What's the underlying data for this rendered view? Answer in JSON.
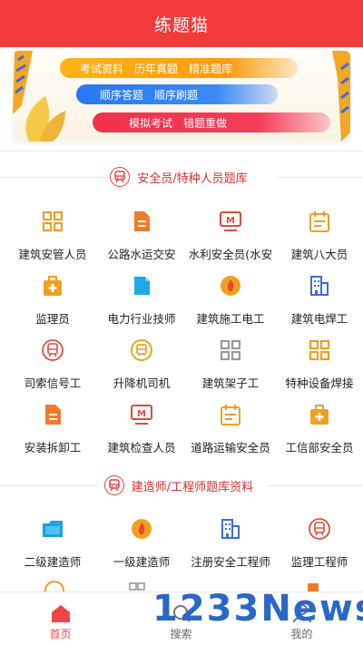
{
  "header": {
    "title": "练题猫"
  },
  "banner": {
    "row1": [
      "考试资料",
      "历年真题",
      "精准题库"
    ],
    "row2": [
      "顺序答题",
      "顺序刷题"
    ],
    "row3": [
      "模拟考试",
      "错题重做"
    ],
    "colors": {
      "orange": "#ffa515",
      "blue": "#2f7ff2",
      "red": "#f2334e"
    }
  },
  "section1": {
    "title": "安全员/特种人员题库",
    "items": [
      {
        "label": "建筑安管人员",
        "icon": "grid-icon"
      },
      {
        "label": "公路水运交安",
        "icon": "document-icon"
      },
      {
        "label": "水利安全员(水安",
        "icon": "monitor-m-icon"
      },
      {
        "label": "建筑八大员",
        "icon": "calendar-icon"
      },
      {
        "label": "监理员",
        "icon": "medical-kit-icon"
      },
      {
        "label": "电力行业技师",
        "icon": "file-icon"
      },
      {
        "label": "建筑施工电工",
        "icon": "fire-icon"
      },
      {
        "label": "建筑电焊工",
        "icon": "building-icon"
      },
      {
        "label": "司索信号工",
        "icon": "train-icon"
      },
      {
        "label": "升降机司机",
        "icon": "bus-icon"
      },
      {
        "label": "建筑架子工",
        "icon": "grid-icon"
      },
      {
        "label": "特种设备焊接",
        "icon": "grid-icon"
      },
      {
        "label": "安装拆卸工",
        "icon": "document-icon"
      },
      {
        "label": "建筑检查人员",
        "icon": "monitor-m-icon"
      },
      {
        "label": "道路运输安全员",
        "icon": "calendar-icon"
      },
      {
        "label": "工信部安全员",
        "icon": "medical-kit-icon"
      }
    ]
  },
  "section2": {
    "title": "建造师/工程师题库资料",
    "items": [
      {
        "label": "二级建造师",
        "icon": "folder-icon"
      },
      {
        "label": "一级建造师",
        "icon": "fire-icon"
      },
      {
        "label": "注册安全工程师",
        "icon": "building-icon"
      },
      {
        "label": "监理工程师",
        "icon": "train-icon"
      }
    ]
  },
  "tabs": [
    {
      "label": "首页",
      "icon": "home-icon",
      "active": true
    },
    {
      "label": "搜索",
      "icon": "search-icon",
      "active": false
    },
    {
      "label": "我的",
      "icon": "user-icon",
      "active": false
    }
  ],
  "watermark": {
    "text_a": "1233",
    "text_b": "News"
  }
}
